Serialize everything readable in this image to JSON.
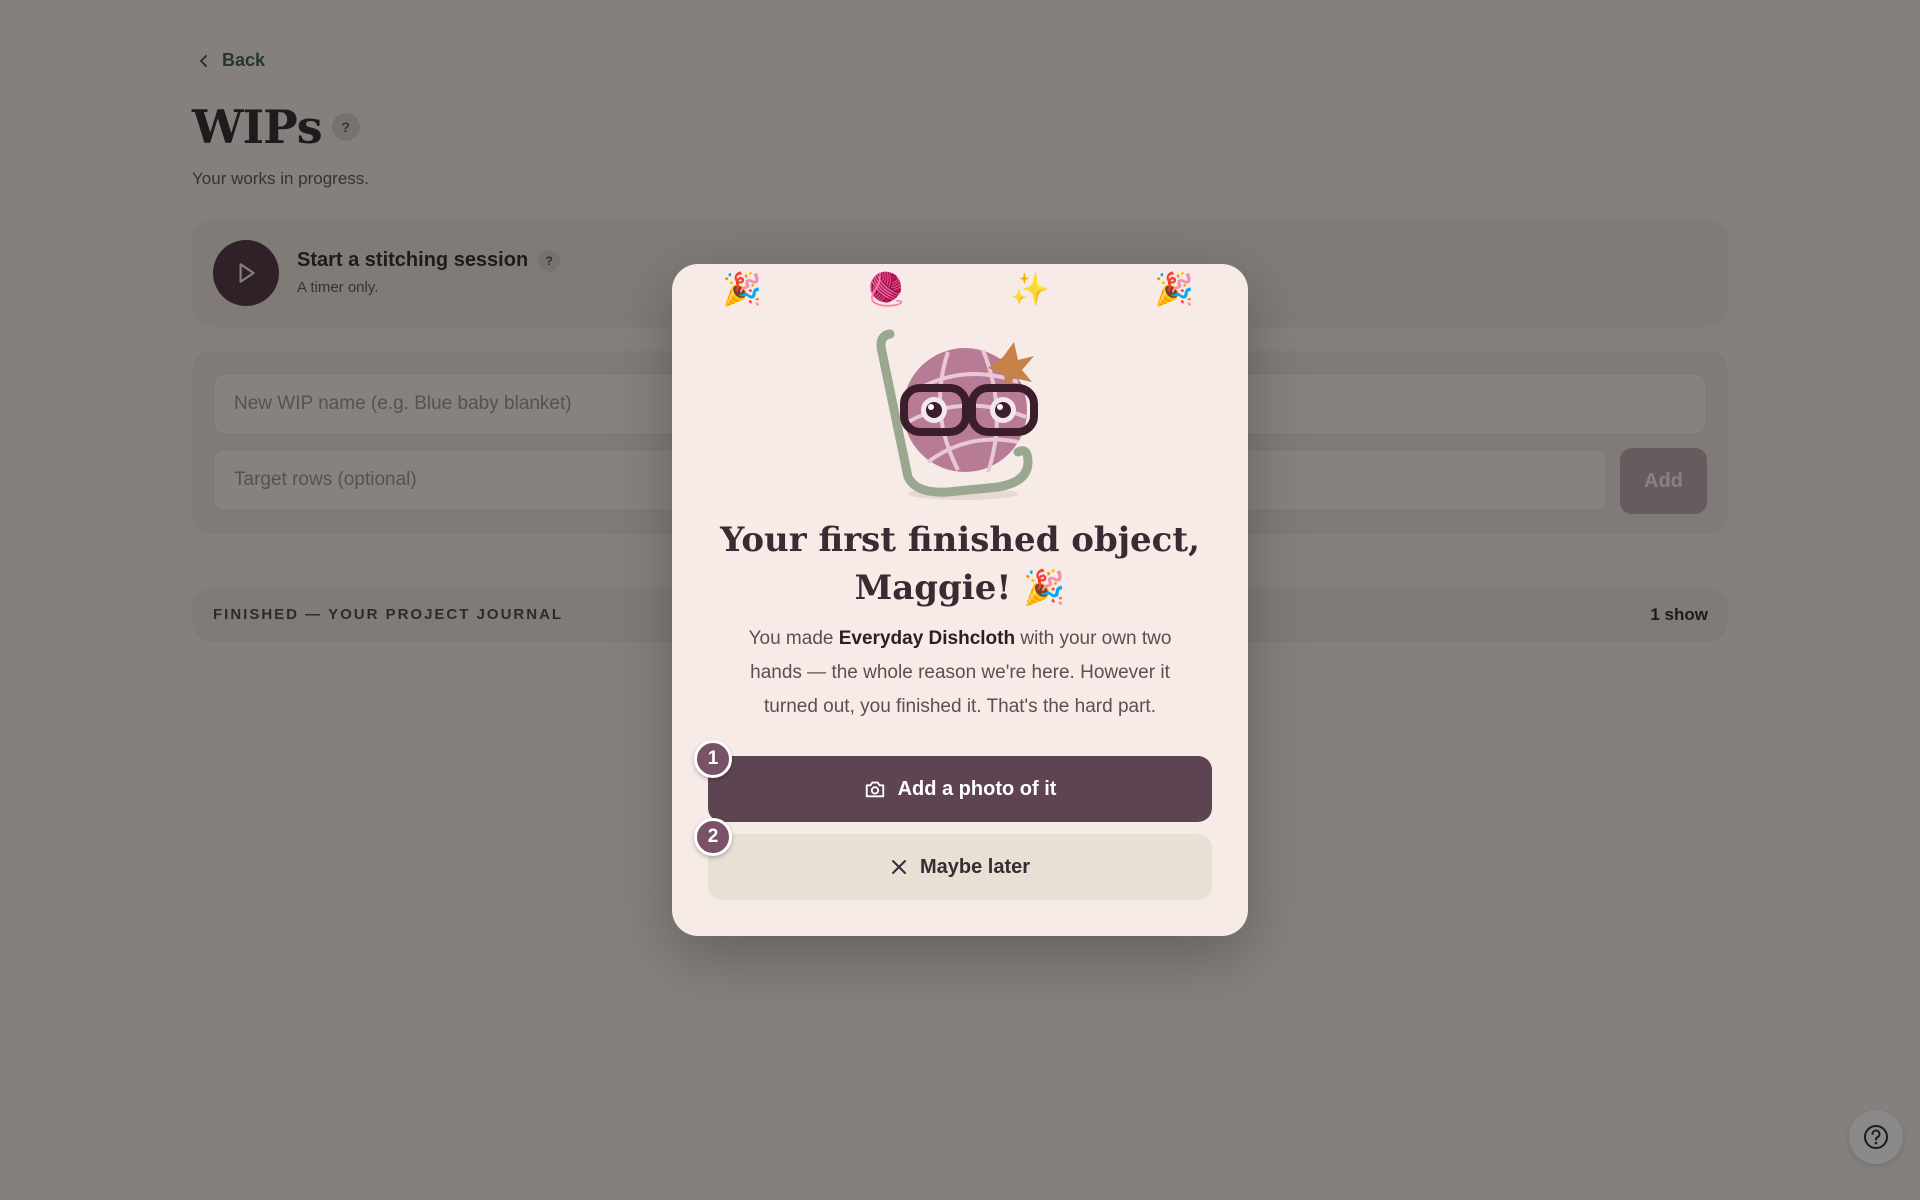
{
  "nav": {
    "back_label": "Back"
  },
  "header": {
    "title": "WIPs",
    "help_glyph": "?",
    "subtitle": "Your works in progress."
  },
  "session": {
    "title": "Start a stitching session",
    "help_glyph": "?",
    "subtitle": "A timer only."
  },
  "form": {
    "name_placeholder": "New WIP name (e.g. Blue baby blanket)",
    "rows_placeholder": "Target rows (optional)",
    "add_label": "Add"
  },
  "journal": {
    "label": "FINISHED — YOUR PROJECT JOURNAL",
    "count": "1 show"
  },
  "modal": {
    "confetti": [
      "🎉",
      "🧶",
      "✨",
      "🎉"
    ],
    "title_line1": "Your first finished object,",
    "title_line2": "Maggie! 🎉",
    "body_prefix": "You made ",
    "project_name": "Everyday Dishcloth",
    "body_suffix": " with your own two hands — the whole reason we're here. However it turned out, you finished it. That's the hard part.",
    "primary_label": "Add a photo of it",
    "secondary_label": "Maybe later",
    "step_1": "1",
    "step_2": "2"
  },
  "icons": {
    "back": "chevron-left-icon",
    "play": "play-icon",
    "camera": "camera-icon",
    "close": "close-icon",
    "help": "help-circle-icon",
    "mascot": "yarn-ball-mascot-icon"
  },
  "colors": {
    "accent": "#5e4452",
    "badge": "#7a5268",
    "back_link": "#3f5a38",
    "modal_bg": "#f6ebe6"
  }
}
